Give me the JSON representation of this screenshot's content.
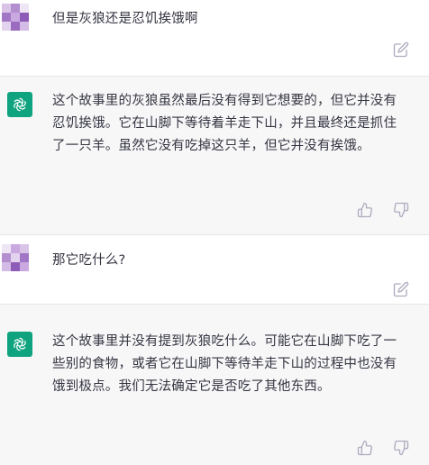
{
  "conversation": [
    {
      "role": "user",
      "text": "但是灰狼还是忍饥挨饿啊",
      "icons": [
        "edit-icon"
      ]
    },
    {
      "role": "assistant",
      "text": "这个故事里的灰狼虽然最后没有得到它想要的，但它并没有忍饥挨饿。它在山脚下等待着羊走下山，并且最终还是抓住了一只羊。虽然它没有吃掉这只羊，但它并没有挨饿。",
      "icons": [
        "thumbs-up-icon",
        "thumbs-down-icon"
      ]
    },
    {
      "role": "user",
      "text": "那它吃什么?",
      "icons": [
        "edit-icon"
      ]
    },
    {
      "role": "assistant",
      "text": "这个故事里并没有提到灰狼吃什么。可能它在山脚下吃了一些别的食物，或者它在山脚下等待羊走下山的过程中也没有饿到极点。我们无法确定它是否吃了其他东西。",
      "icons": [
        "thumbs-up-icon",
        "thumbs-down-icon"
      ]
    }
  ],
  "colors": {
    "assistant_bg": "#f7f7f8",
    "user_bg": "#ffffff",
    "brand": "#10a37f",
    "icon": "#acacbe"
  }
}
